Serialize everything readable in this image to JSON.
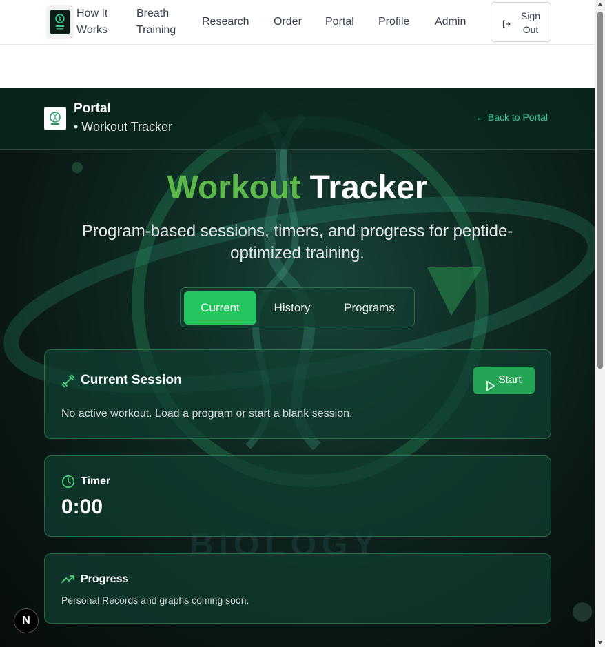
{
  "nav": {
    "items": [
      {
        "label_line1": "How It",
        "label_line2": "Works"
      },
      {
        "label_line1": "Breath",
        "label_line2": "Training"
      },
      {
        "label": "Research"
      },
      {
        "label": "Order"
      },
      {
        "label": "Portal"
      },
      {
        "label": "Profile"
      },
      {
        "label": "Admin"
      }
    ],
    "signout": {
      "line1": "Sign",
      "line2": "Out"
    }
  },
  "subheader": {
    "title": "Portal",
    "subtitle": "• Workout Tracker",
    "back_link": "← Back to Portal"
  },
  "hero": {
    "title_green": "Workout",
    "title_white": "Tracker",
    "subtitle": "Program-based sessions, timers, and progress for peptide-optimized training.",
    "background_text": "BIOLOGY"
  },
  "tabs": [
    {
      "label": "Current",
      "active": true
    },
    {
      "label": "History",
      "active": false
    },
    {
      "label": "Programs",
      "active": false
    }
  ],
  "current_session": {
    "title": "Current Session",
    "start_label": "Start",
    "message": "No active workout. Load a program or start a blank session."
  },
  "timer": {
    "title": "Timer",
    "value": "0:00"
  },
  "progress": {
    "title": "Progress",
    "message": "Personal Records and graphs coming soon."
  },
  "fab": {
    "label": "N"
  },
  "colors": {
    "accent_green": "#22c55e",
    "title_green": "#5dba4a",
    "link_green": "#34d399"
  }
}
